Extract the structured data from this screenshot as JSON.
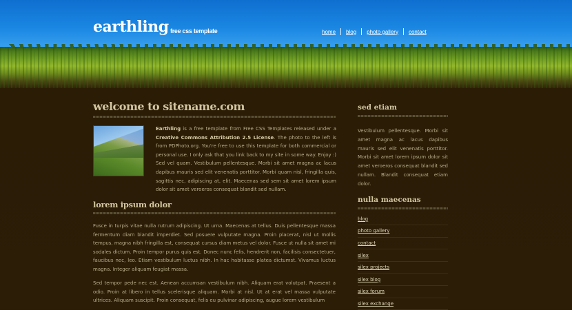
{
  "header": {
    "logo": "earthling",
    "tagline": "free css template",
    "nav": [
      "home",
      "blog",
      "photo gallery",
      "contact"
    ]
  },
  "main": {
    "title": "welcome to sitename.com",
    "intro_strong1": "Earthling",
    "intro_text1": " is a free template from Free CSS Templates released under a ",
    "intro_strong2": "Creative Commons Attribution 2.5 License",
    "intro_text2": ". The photo to the left is from PDPhoto.org. You're free to use this template for both commercial or personal use. I only ask that you link back to my site in some way. Enjoy :) Sed vel quam. Vestibulum pellentesque. Morbi sit amet magna ac lacus dapibus mauris sed elit venenatis porttitor. Morbi quam nisl, fringilla quis, sagittis nec, adipiscing at, elit. Maecenas sed sem sit amet lorem ipsum dolor sit amet veroeros consequat blandit sed nullam.",
    "section_title": "lorem ipsum dolor",
    "para1": "Fusce in turpis vitae nulla rutrum adipiscing. Ut urna. Maecenas at tellus. Duis pellentesque massa fermentum diam blandit imperdiet. Sed posuere vulputate magna. Proin placerat, nisl ut mollis tempus, magna nibh fringilla est, consequat cursus diam metus vel dolor. Fusce ut nulla sit amet mi sodales dictum. Proin tempor purus quis est. Donec nunc felis, hendrerit non, facilisis consectetuer, faucibus nec, leo. Etiam vestibulum luctus nibh. In hac habitasse platea dictumst. Vivamus luctus magna. Integer aliquam feugiat massa.",
    "para2": "Sed tempor pede nec est. Aenean accumsan vestibulum nibh. Aliquam erat volutpat. Praesent a odio. Proin at libero in tellus scelerisque aliquam. Morbi at nisl. Ut at erat vel massa vulputate ultrices. Aliquam suscipit. Proin consequat, felis eu pulvinar adipiscing, augue lorem vestibulum"
  },
  "sidebar": {
    "title1": "sed etiam",
    "text1": "Vestibulum pellentesque. Morbi sit amet magna ac lacus dapibus mauris sed elit venenatis porttitor. Morbi sit amet lorem ipsum dolor sit amet veroeros consequat blandit sed nullam. Blandit consequat etiam dolor.",
    "title2": "nulla maecenas",
    "links": [
      "blog",
      "photo gallery",
      "contact",
      "silex",
      "silex projects",
      "silex blog",
      "silex forum",
      "silex exchange"
    ]
  }
}
